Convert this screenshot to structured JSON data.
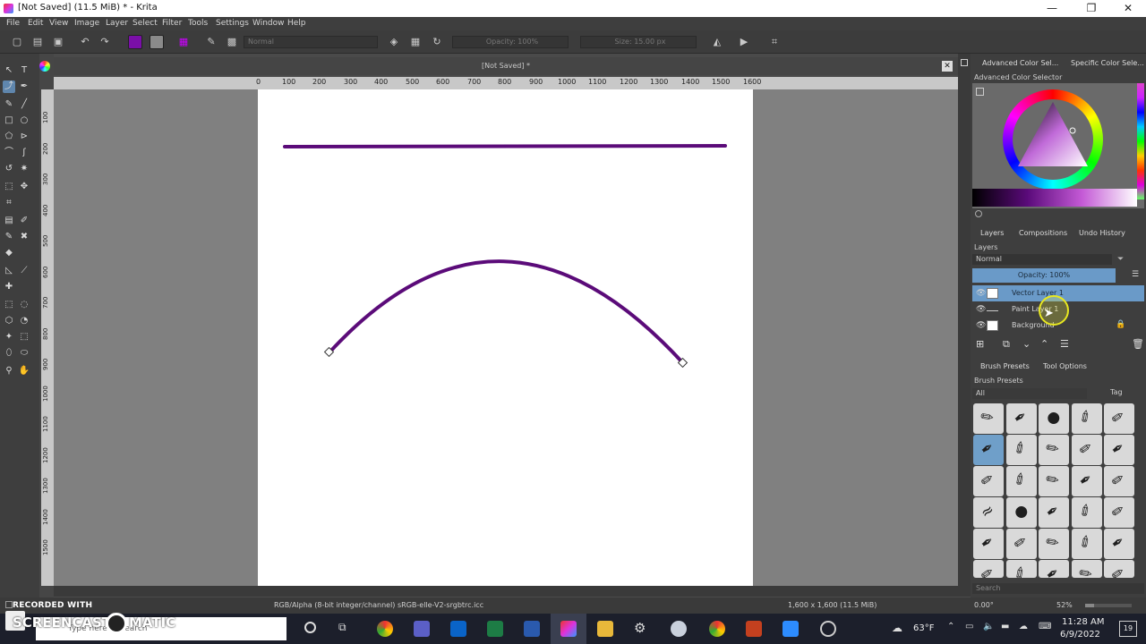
{
  "window": {
    "title": "[Not Saved]  (11.5 MiB)  * - Krita",
    "controls": {
      "minimize": "—",
      "maximize": "❐",
      "close": "✕"
    }
  },
  "menu": [
    "File",
    "Edit",
    "View",
    "Image",
    "Layer",
    "Select",
    "Filter",
    "Tools",
    "Settings",
    "Window",
    "Help"
  ],
  "toolbar": {
    "blend_mode": "Normal",
    "opacity": "Opacity: 100%",
    "size": "Size: 15.00 px",
    "foreground_color": "#7a0fa8",
    "background_color": "#8a8a8a"
  },
  "document": {
    "tab_title": "[Not Saved]  *",
    "ruler_top": [
      "0",
      "100",
      "200",
      "300",
      "400",
      "500",
      "600",
      "700",
      "800",
      "900",
      "1000",
      "1100",
      "1200",
      "1300",
      "1400",
      "1500",
      "1600"
    ],
    "ruler_left": [
      "100",
      "200",
      "300",
      "400",
      "500",
      "600",
      "700",
      "800",
      "900",
      "1000",
      "1100",
      "1200",
      "1300",
      "1400",
      "1500"
    ],
    "stroke_color": "#5b0b79"
  },
  "status": {
    "color_space": "RGB/Alpha (8-bit integer/channel)  sRGB-elle-V2-srgbtrc.icc",
    "dimensions": "1,600 x 1,600 (11.5 MiB)",
    "rotation": "0.00°",
    "zoom": "52%"
  },
  "docker": {
    "color_tabs": [
      "Advanced Color Sel...",
      "Specific Color Sele..."
    ],
    "color_title": "Advanced Color Selector",
    "layer_tabs": [
      "Layers",
      "Compositions",
      "Undo History"
    ],
    "layers_title": "Layers",
    "layer_blend": "Normal",
    "layer_opacity": "Opacity:  100%",
    "layers": [
      {
        "name": "Vector Layer 1",
        "selected": true
      },
      {
        "name": "Paint Layer 1",
        "selected": false
      },
      {
        "name": "Background",
        "selected": false
      }
    ],
    "brush_tabs": [
      "Brush Presets",
      "Tool Options"
    ],
    "brush_title": "Brush Presets",
    "brush_filter": "All",
    "brush_tag": "Tag",
    "search_placeholder": "Search"
  },
  "taskbar": {
    "search_placeholder": "Type here to search",
    "weather": "63°F",
    "time": "11:28 AM",
    "date": "6/9/2022",
    "notifications": "19"
  },
  "watermark": {
    "line1": "RECORDED WITH",
    "line2": "SCREENCAST",
    "line3": "MATIC"
  }
}
